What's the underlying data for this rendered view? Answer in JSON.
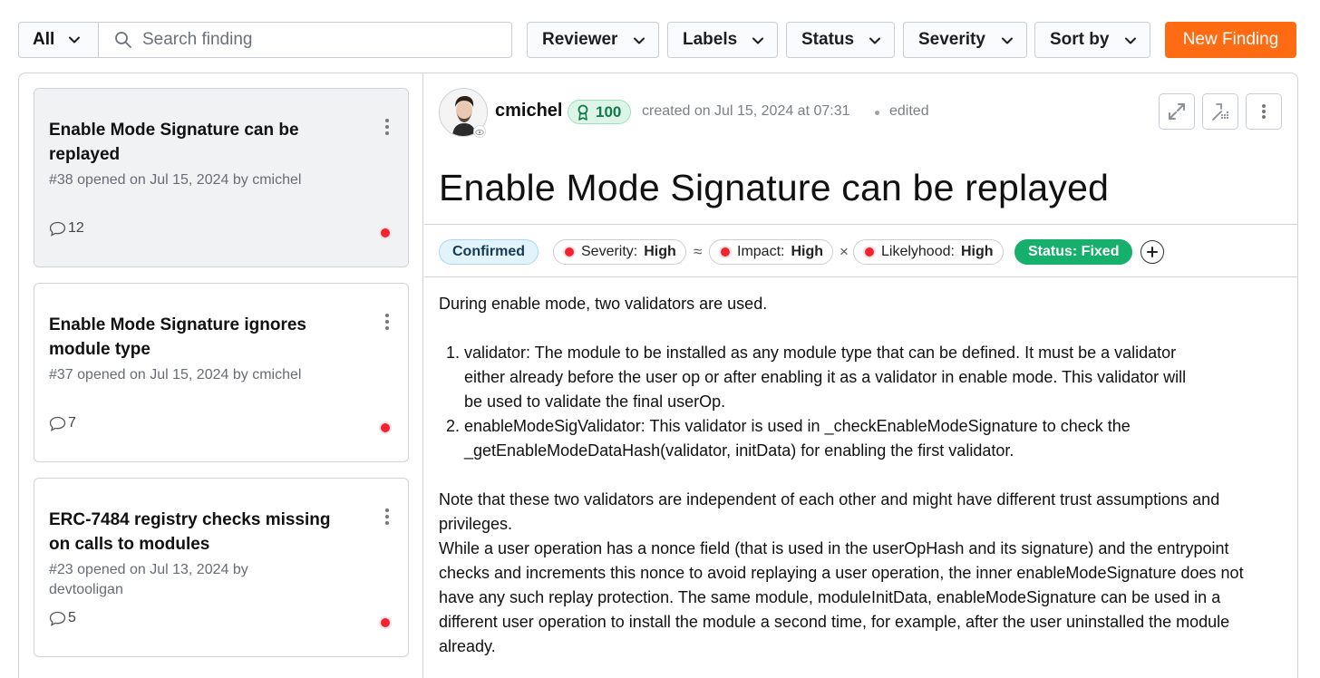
{
  "toolbar": {
    "scope_label": "All",
    "search_placeholder": "Search finding",
    "filters": [
      "Reviewer",
      "Labels",
      "Status",
      "Severity",
      "Sort by"
    ],
    "new_finding_label": "New Finding"
  },
  "findings": [
    {
      "title": "Enable Mode Signature can be replayed",
      "meta": "#38 opened on Jul 15, 2024 by cmichel",
      "comments": "12"
    },
    {
      "title": "Enable Mode Signature ignores module type",
      "meta": "#37 opened on Jul 15, 2024 by cmichel",
      "comments": "7"
    },
    {
      "title": "ERC-7484 registry checks missing on calls to modules",
      "meta": "#23 opened on Jul 13, 2024 by devtooligan",
      "comments": "5"
    }
  ],
  "detail": {
    "author": "cmichel",
    "score": "100",
    "created": "created on Jul 15, 2024 at 07:31",
    "edited": "edited",
    "title": "Enable Mode Signature can be replayed",
    "labels": {
      "confirmed": "Confirmed",
      "severity_key": "Severity:",
      "severity_val": "High",
      "approx": "≈",
      "impact_key": "Impact:",
      "impact_val": "High",
      "times": "×",
      "likelihood_key": "Likelyhood:",
      "likelihood_val": "High",
      "status": "Status: Fixed"
    },
    "body": {
      "intro": "During enable mode, two validators are used.",
      "list": [
        "validator: The module to be installed as any module type that can be defined. It must be a validator either already before the user op or after enabling it as a validator in enable mode. This validator will be used to validate the final userOp.",
        "enableModeSigValidator: This validator is used in _checkEnableModeSignature to check the _getEnableModeDataHash(validator, initData) for enabling the first validator."
      ],
      "para1": "Note that these two validators are independent of each other and might have different trust assumptions and privileges.",
      "para2": "While a user operation has a nonce field (that is used in the userOpHash and its signature) and the entrypoint checks and increments this nonce to avoid replaying a user operation, the inner enableModeSignature does not have any such replay protection. The same module, moduleInitData, enableModeSignature can be used in a different user operation to install the module a second time, for example, after the user uninstalled the module already."
    }
  },
  "icons": {
    "search": "search-icon",
    "chevron": "chevron-down-icon",
    "kebab": "kebab-icon",
    "comment": "comment-icon",
    "expand": "expand-icon",
    "export": "export-icon",
    "plus": "plus-icon"
  },
  "colors": {
    "accent": "#ff6b12",
    "fixed": "#16b06c",
    "severity_dot": "#f2232e",
    "score": "#dcf5e8"
  }
}
